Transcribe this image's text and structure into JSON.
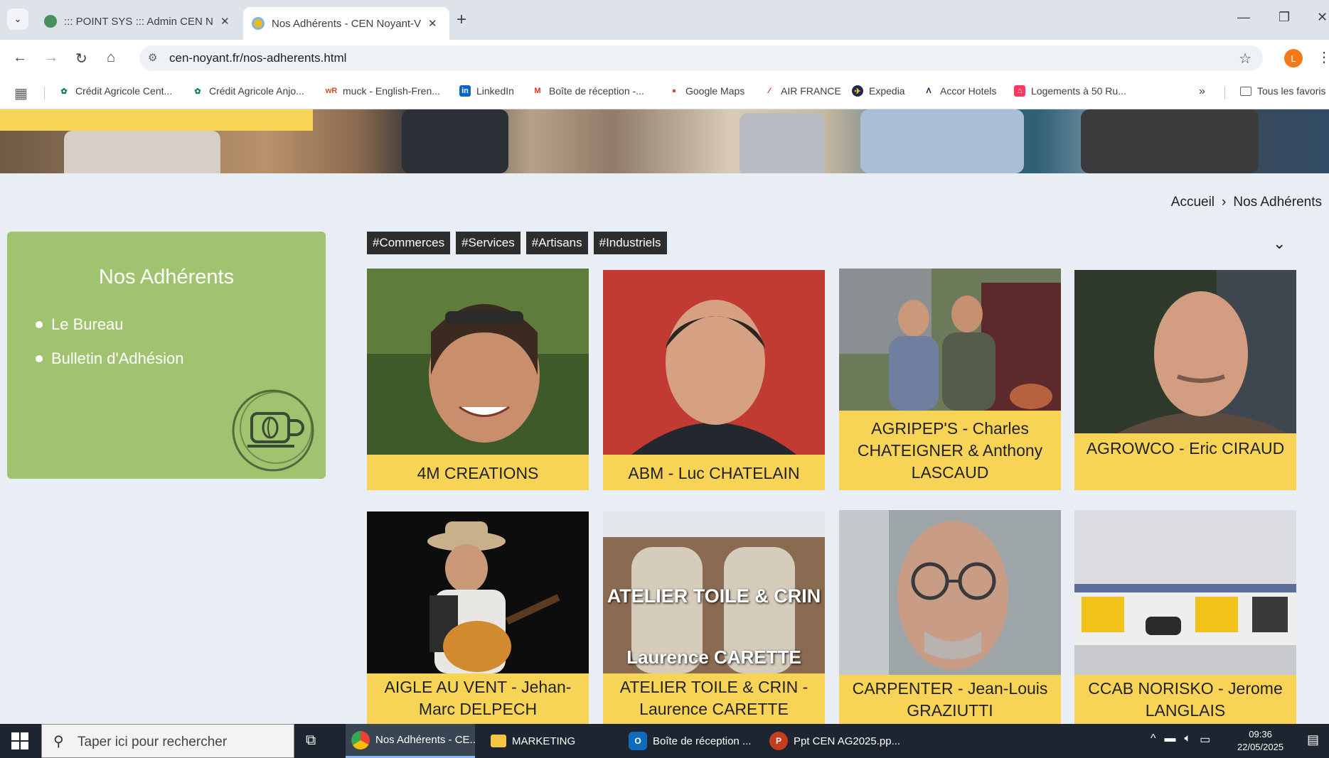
{
  "browser": {
    "tabs": [
      {
        "title": "::: POINT SYS ::: Admin CEN Noy",
        "close": "✕",
        "icon_color": "#4b8f5e"
      },
      {
        "title": "Nos Adhérents - CEN Noyant-V",
        "close": "✕",
        "icon_color": "#e7b923"
      }
    ],
    "new_tab": "+",
    "url": "cen-noyant.fr/nos-adherents.html",
    "profile_initial": "L",
    "profile_color": "#f27a1a"
  },
  "bookmarks": {
    "items": [
      {
        "label": "Crédit Agricole Cent...",
        "icon": "ca-icon",
        "color": "#0b7a5b"
      },
      {
        "label": "Crédit Agricole Anjo...",
        "icon": "ca-icon",
        "color": "#0b7a5b"
      },
      {
        "label": "muck - English-Fren...",
        "icon": "wr-icon",
        "color": "#d14a2b"
      },
      {
        "label": "LinkedIn",
        "icon": "linkedin-icon",
        "color": "#0a66c2"
      },
      {
        "label": "Boîte de réception -...",
        "icon": "gmail-icon",
        "color": "#d93025"
      },
      {
        "label": "Google Maps",
        "icon": "maps-icon",
        "color": "#ea4335"
      },
      {
        "label": "AIR FRANCE",
        "icon": "airfrance-icon",
        "color": "#d0021b"
      },
      {
        "label": "Expedia",
        "icon": "expedia-icon",
        "color": "#1f2b4d"
      },
      {
        "label": "Accor Hotels",
        "icon": "accor-icon",
        "color": "#1e1852"
      },
      {
        "label": "Logements à 50 Ru...",
        "icon": "airbnb-icon",
        "color": "#ff385c"
      }
    ],
    "more": "»",
    "all_bookmarks": "Tous les favoris"
  },
  "page": {
    "breadcrumb": {
      "home": "Accueil",
      "sep": "›",
      "current": "Nos Adhérents"
    },
    "sidebar": {
      "title": "Nos Adhérents",
      "links": [
        "Le Bureau",
        "Bulletin d'Adhésion"
      ],
      "bg_color": "#9fc36e"
    },
    "filters": [
      "#Commerces",
      "#Services",
      "#Artisans",
      "#Industriels"
    ],
    "members": [
      {
        "name": "4M CREATIONS"
      },
      {
        "name": "ABM - Luc CHATELAIN"
      },
      {
        "name": "AGRIPEP'S - Charles CHATEIGNER & Anthony LASCAUD"
      },
      {
        "name": "AGROWCO - Eric CIRAUD"
      },
      {
        "name": "AIGLE AU VENT - Jehan-Marc DELPECH"
      },
      {
        "name": "ATELIER TOILE & CRIN - Laurence CARETTE",
        "overlay_top": "ATELIER TOILE & CRIN",
        "overlay_bottom": "Laurence CARETTE"
      },
      {
        "name": "CARPENTER - Jean-Louis GRAZIUTTI"
      },
      {
        "name": "CCAB NORISKO - Jerome LANGLAIS"
      }
    ],
    "card_color": "#f7d455"
  },
  "taskbar": {
    "search_placeholder": "Taper ici pour rechercher",
    "apps": [
      {
        "label": "Nos Adhérents - CE...",
        "icon": "chrome-icon"
      },
      {
        "label": "MARKETING",
        "icon": "folder-icon"
      },
      {
        "label": "Boîte de réception ...",
        "icon": "outlook-icon"
      },
      {
        "label": "Ppt CEN AG2025.pp...",
        "icon": "powerpoint-icon"
      }
    ],
    "time": "09:36",
    "date": "22/05/2025"
  }
}
